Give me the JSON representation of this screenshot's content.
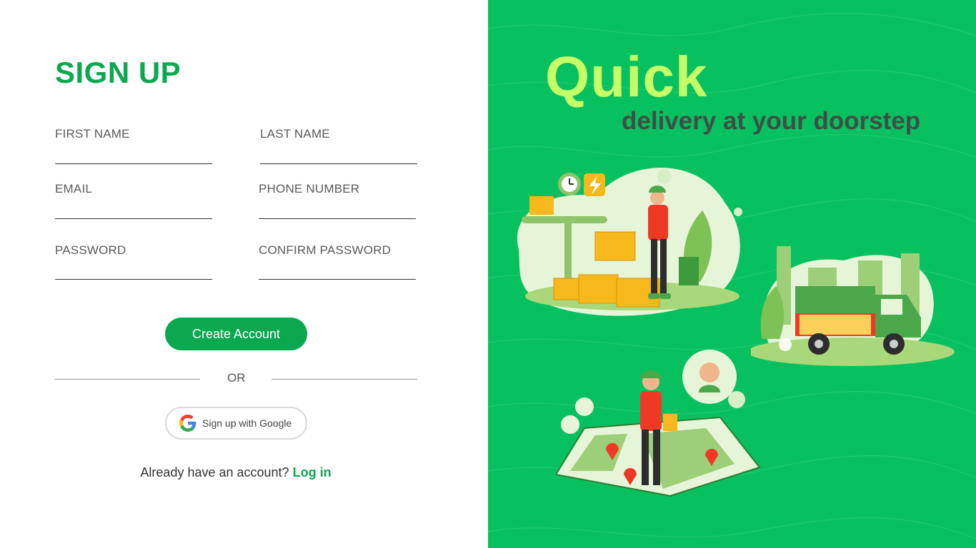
{
  "form": {
    "title": "SIGN UP",
    "fields": {
      "first_name": "FIRST NAME",
      "last_name": "LAST NAME",
      "email": "EMAIL",
      "phone": "PHONE NUMBER",
      "password": "PASSWORD",
      "confirm_password": "CONFIRM PASSWORD"
    },
    "create_button": "Create Account",
    "divider_text": "OR",
    "google_button": "Sign up with Google",
    "login_prompt": "Already have an account?",
    "login_link": "Log in"
  },
  "hero": {
    "headline": "Quick",
    "tagline": "delivery at your doorstep"
  },
  "colors": {
    "brand_green": "#0aa84f",
    "panel_green": "#07c060",
    "headline_lime": "#c6ff66",
    "tagline_dark": "#3e4f44"
  },
  "icons": [
    "google-icon",
    "clock-icon",
    "lightning-icon",
    "delivery-truck-icon",
    "location-pin-icon"
  ]
}
